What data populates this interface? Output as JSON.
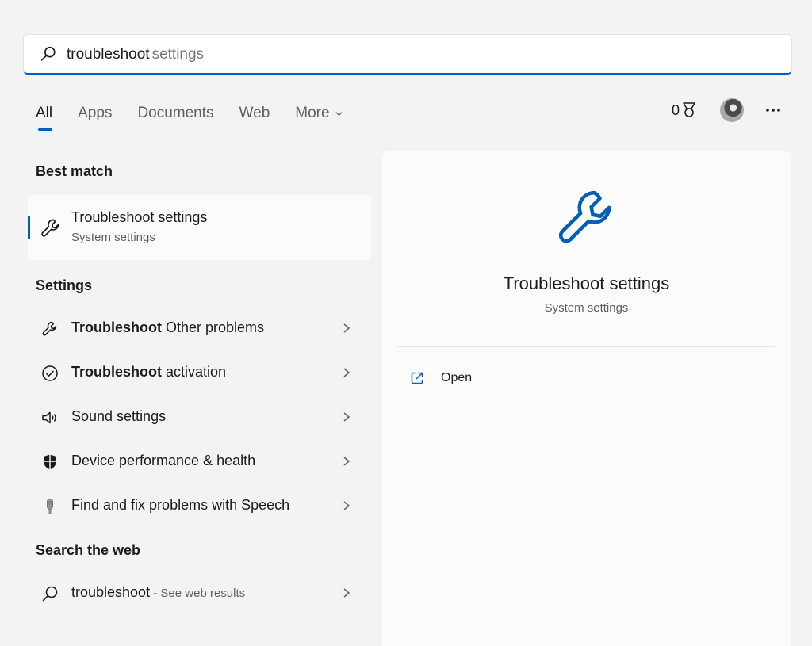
{
  "search": {
    "typed": "troubleshoot",
    "suggestion": " settings"
  },
  "tabs": [
    {
      "label": "All",
      "active": true
    },
    {
      "label": "Apps"
    },
    {
      "label": "Documents"
    },
    {
      "label": "Web"
    },
    {
      "label": "More"
    }
  ],
  "header": {
    "points": "0"
  },
  "best_match": {
    "section_title": "Best match",
    "title": "Troubleshoot settings",
    "subtitle": "System settings",
    "icon": "wrench-icon"
  },
  "settings": {
    "section_title": "Settings",
    "items": [
      {
        "bold": "Troubleshoot",
        "rest": " Other problems",
        "icon": "wrench-icon"
      },
      {
        "bold": "Troubleshoot",
        "rest": " activation",
        "icon": "check-circle-icon"
      },
      {
        "bold": "",
        "rest": "Sound settings",
        "icon": "speaker-icon"
      },
      {
        "bold": "",
        "rest": "Device performance & health",
        "icon": "shield-icon"
      },
      {
        "bold": "",
        "rest": "Find and fix problems with Speech",
        "icon": "microphone-icon"
      }
    ]
  },
  "web": {
    "section_title": "Search the web",
    "query": "troubleshoot",
    "suffix": " - See web results"
  },
  "preview": {
    "title": "Troubleshoot settings",
    "subtitle": "System settings",
    "open_label": "Open"
  },
  "colors": {
    "accent": "#005fb8",
    "background": "#f3f3f3",
    "panel": "#fbfbfb"
  }
}
